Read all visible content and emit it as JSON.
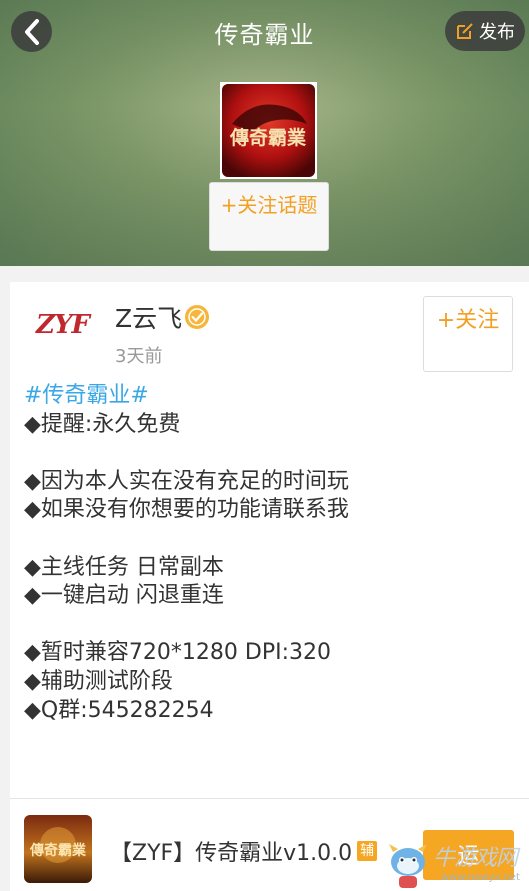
{
  "header": {
    "title": "传奇霸业",
    "publish_label": "发布",
    "follow_topic_label": "+关注话题",
    "topic_logo_text": "傳奇霸業"
  },
  "post": {
    "author": "Z云飞",
    "avatar_text": "ZYF",
    "time": "3天前",
    "follow_label": "+关注",
    "lines": [
      "#传奇霸业#",
      "◆提醒:永久免费",
      "",
      "◆因为本人实在没有充足的时间玩",
      "◆如果没有你想要的功能请联系我",
      "",
      "◆主线任务 日常副本",
      "◆一键启动 闪退重连",
      "",
      "◆暂时兼容720*1280 DPI:320",
      "◆辅助测试阶段",
      "◆Q群:545282254"
    ]
  },
  "app": {
    "name": "【ZYF】传奇霸业v1.0.0",
    "badge": "辅",
    "run_label": "运",
    "icon_text": "傳奇霸業"
  },
  "watermark": {
    "text": "牛游戏网",
    "url": "www.newyx.net"
  },
  "colors": {
    "accent": "#f2a024",
    "hashtag": "#3aa7e6",
    "run_button": "#f5a623"
  }
}
